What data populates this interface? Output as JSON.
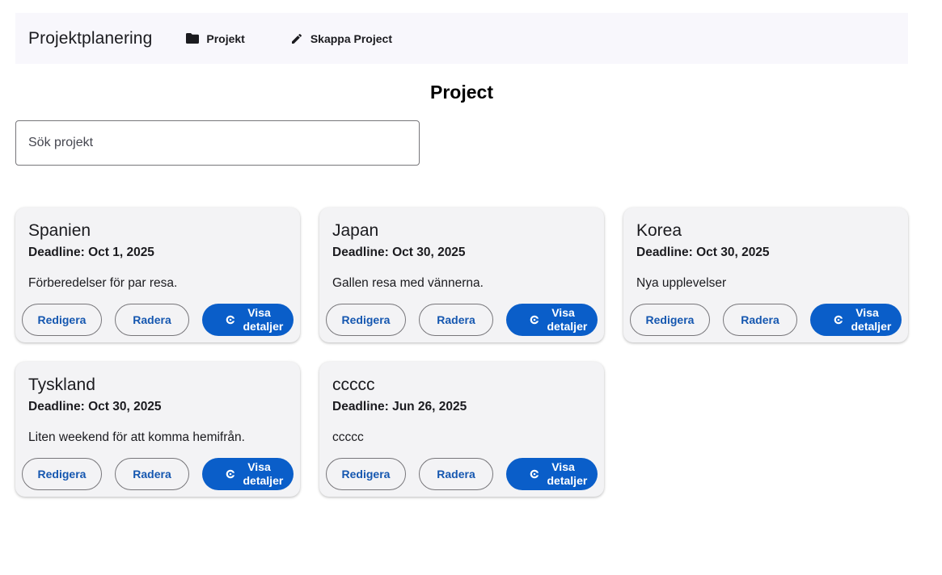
{
  "nav": {
    "brand": "Projektplanering",
    "links": [
      {
        "label": "Projekt",
        "icon": "folder-icon"
      },
      {
        "label": "Skappa Project",
        "icon": "pencil-icon"
      }
    ]
  },
  "page": {
    "title": "Project"
  },
  "search": {
    "placeholder": "Sök projekt"
  },
  "colors": {
    "primary": "#0a5ec9",
    "outline_text": "#1557b0",
    "card_bg": "#f3f3f5",
    "nav_bg": "#f8f7fc"
  },
  "projects": [
    {
      "name": "Spanien",
      "deadline": "Deadline: Oct 1, 2025",
      "description": "Förberedelser för par resa.",
      "edit": "Redigera",
      "delete": "Radera",
      "details": "Visa detaljer"
    },
    {
      "name": "Japan",
      "deadline": "Deadline: Oct 30, 2025",
      "description": "Gallen resa med vännerna.",
      "edit": "Redigera",
      "delete": "Radera",
      "details": "Visa detaljer"
    },
    {
      "name": "Korea",
      "deadline": "Deadline: Oct 30, 2025",
      "description": "Nya upplevelser",
      "edit": "Redigera",
      "delete": "Radera",
      "details": "Visa detaljer"
    },
    {
      "name": "Tyskland",
      "deadline": "Deadline: Oct 30, 2025",
      "description": "Liten weekend för att komma hemifrån.",
      "edit": "Redigera",
      "delete": "Radera",
      "details": "Visa detaljer"
    },
    {
      "name": "ccccc",
      "deadline": "Deadline: Jun 26, 2025",
      "description": "ccccc",
      "edit": "Redigera",
      "delete": "Radera",
      "details": "Visa detaljer"
    }
  ]
}
